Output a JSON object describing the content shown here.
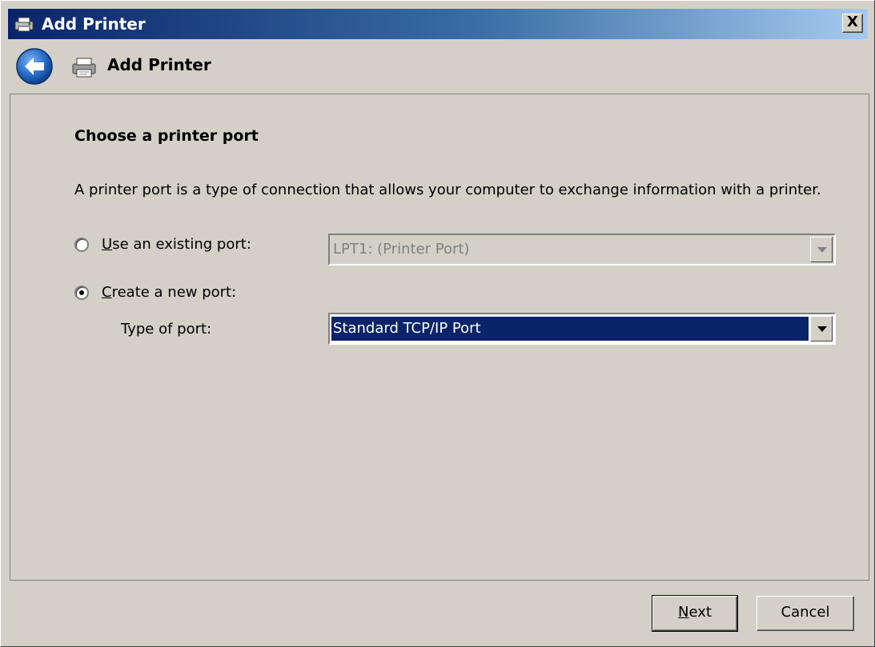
{
  "window": {
    "title": "Add Printer",
    "close_label": "X"
  },
  "header": {
    "title": "Add Printer"
  },
  "main": {
    "heading": "Choose a printer port",
    "description": "A printer port is a type of connection that allows your computer to exchange information with a printer.",
    "existing_port": {
      "label_mnemonic": "U",
      "label_rest": "se an existing port:",
      "selected": false,
      "value": "LPT1: (Printer Port)",
      "enabled": false
    },
    "new_port": {
      "label_mnemonic": "C",
      "label_rest": "reate a new port:",
      "selected": true
    },
    "type_of_port": {
      "label": "Type of port:",
      "value": "Standard TCP/IP Port"
    }
  },
  "footer": {
    "next_mnemonic": "N",
    "next_rest": "ext",
    "cancel_label": "Cancel"
  },
  "colors": {
    "titlebar_start": "#0a246a",
    "titlebar_end": "#a6caf0",
    "selection": "#0a246a",
    "face": "#d4d0c8"
  },
  "icons": {
    "title": "printer-icon",
    "back": "back-arrow-icon",
    "header": "printer-icon",
    "close": "close-icon",
    "dropdown": "chevron-down-icon"
  }
}
